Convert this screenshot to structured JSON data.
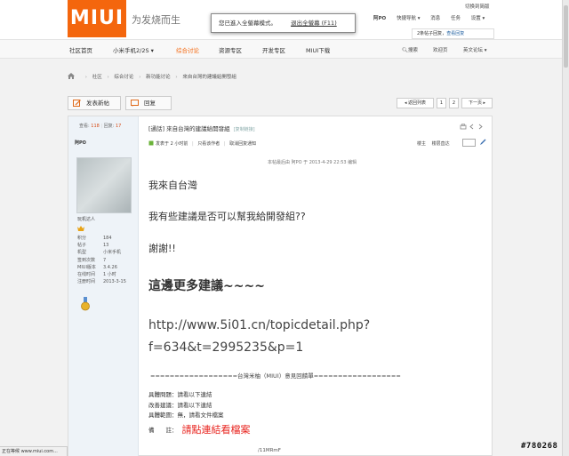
{
  "header": {
    "logo": "MIUI",
    "slogan": "为发烧而生",
    "top_right_link": "切换到简版",
    "fullscreen_tip": "您已進入全螢幕模式。",
    "fullscreen_exit": "退出全螢幕 (F11)",
    "user": "阿PO",
    "quick_nav": "快捷导航 ▾",
    "messages": "消息",
    "tasks": "任务",
    "settings": "设置 ▾",
    "notice_count": "2条帖子回复，",
    "notice_link": "查看回复"
  },
  "nav": {
    "items": [
      "社区首页",
      "小米手机2/2S ▾",
      "综合讨论",
      "资源专区",
      "开发专区",
      "MIUI下载"
    ],
    "active_index": 2,
    "search": "搜索",
    "welcome": "欢迎页",
    "english": "英文论坛 ▾"
  },
  "breadcrumb": [
    "社区",
    "综合讨论",
    "新功能讨论",
    "來自台灣的建議給開發組"
  ],
  "actions": {
    "new_post": "发表新帖",
    "reply": "回复"
  },
  "pager": {
    "back": "◂ 返回列表",
    "page1": "1",
    "page2": "2",
    "next": "下一页 ▸"
  },
  "post": {
    "views_label": "查看:",
    "views": "118",
    "replies_label": "回复:",
    "replies": "17",
    "title_tag": "[通話]",
    "title": "來自台灣的建議給開發組",
    "copy_link": "[复制链接]",
    "author": "阿PO",
    "rank": "玩机达人",
    "author_info": [
      {
        "k": "积分",
        "v": "184"
      },
      {
        "k": "帖子",
        "v": "13"
      },
      {
        "k": "机型",
        "v": "小米手机"
      },
      {
        "k": "签到次数",
        "v": "7"
      },
      {
        "k": "MIUI版本",
        "v": "3.4.26"
      },
      {
        "k": "在线时间",
        "v": "1 小时"
      },
      {
        "k": "注册时间",
        "v": "2013-3-15"
      }
    ],
    "meta": {
      "published": "发表于 2 小时前",
      "only_author": "只看该作者",
      "cancel_notify": "取消回复通知",
      "floor": "楼主",
      "sort": "楼层直达"
    },
    "edited": "本帖最后由 阿PO 于 2013-4-29 22:53 编辑",
    "lines": [
      "我來自台灣",
      "我有些建議是否可以幫我給開發組??",
      "謝謝!!",
      "這邊更多建議~~~~",
      "http://www.5i01.cn/topicdetail.php?",
      "f=634&t=2995235&p=1"
    ],
    "divider": "==================台灣米柚（MIUI）意見回饋單==================",
    "list": [
      "具體問題：請看以下連結",
      "改善建議：請看以下連結",
      "具體範圍：無，請看文件檔案"
    ],
    "note_label": "備　　註：",
    "note_link": "請點連結看檔案",
    "fragment": "/11MRmF"
  },
  "status_bar": "正在等候 www.miui.com...",
  "image_id": "#780268"
}
